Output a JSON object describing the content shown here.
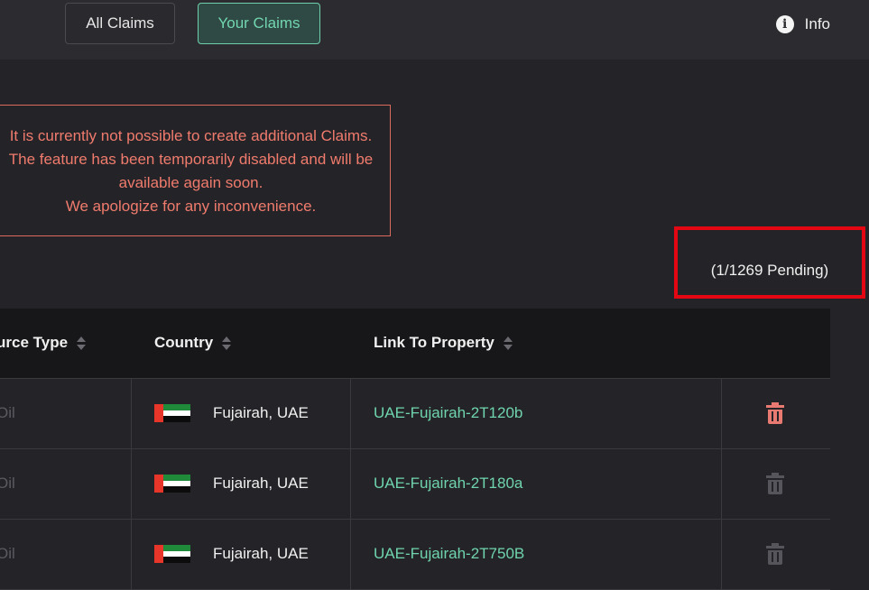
{
  "tabs": {
    "all": "All Claims",
    "yours": "Your Claims"
  },
  "info": {
    "label": "Info"
  },
  "notice": {
    "lines": [
      "It is currently not possible to create additional Claims.",
      "The feature has been temporarily disabled and will be",
      "available again soon.",
      "We apologize for any inconvenience."
    ]
  },
  "pending": "(1/1269 Pending)",
  "table": {
    "headers": {
      "source_type": "urce Type",
      "country": "Country",
      "link": "Link To Property"
    },
    "rows": [
      {
        "source": "Oil",
        "country": "Fujairah, UAE",
        "link": "UAE-Fujairah-2T120b",
        "delete_active": true
      },
      {
        "source": "Oil",
        "country": "Fujairah, UAE",
        "link": "UAE-Fujairah-2T180a",
        "delete_active": false
      },
      {
        "source": "Oil",
        "country": "Fujairah, UAE",
        "link": "UAE-Fujairah-2T750B",
        "delete_active": false
      }
    ]
  },
  "colors": {
    "accent": "#6fd4ad",
    "warning": "#f07b6d",
    "highlight": "#e30613",
    "trash_active": "#e87a72",
    "trash_inactive": "#55555b"
  },
  "icons": {
    "info": "info-icon",
    "delete": "trash-icon",
    "sort": "sort-icon",
    "flag": "uae-flag-icon"
  }
}
